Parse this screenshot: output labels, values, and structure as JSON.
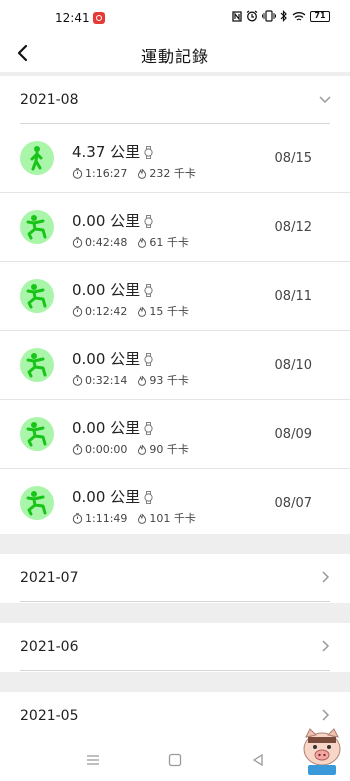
{
  "status": {
    "time": "12:41",
    "battery": "71",
    "left_icons": [
      "notification-icon"
    ],
    "right_icons": [
      "nfc-icon",
      "alarm-icon",
      "vibrate-icon",
      "bluetooth-icon",
      "wifi-icon",
      "battery-icon"
    ]
  },
  "header": {
    "title": "運動記錄"
  },
  "months": [
    {
      "label": "2021-08",
      "expanded": true
    },
    {
      "label": "2021-07",
      "expanded": false
    },
    {
      "label": "2021-06",
      "expanded": false
    },
    {
      "label": "2021-05",
      "expanded": false
    }
  ],
  "records": [
    {
      "distance": "4.37 公里",
      "duration": "1:16:27",
      "calories": "232 千卡",
      "date": "08/15",
      "activity": "walk"
    },
    {
      "distance": "0.00 公里",
      "duration": "0:42:48",
      "calories": "61 千卡",
      "date": "08/12",
      "activity": "workout"
    },
    {
      "distance": "0.00 公里",
      "duration": "0:12:42",
      "calories": "15 千卡",
      "date": "08/11",
      "activity": "workout"
    },
    {
      "distance": "0.00 公里",
      "duration": "0:32:14",
      "calories": "93 千卡",
      "date": "08/10",
      "activity": "workout"
    },
    {
      "distance": "0.00 公里",
      "duration": "0:00:00",
      "calories": "90 千卡",
      "date": "08/09",
      "activity": "workout"
    },
    {
      "distance": "0.00 公里",
      "duration": "1:11:49",
      "calories": "101 千卡",
      "date": "08/07",
      "activity": "workout"
    }
  ],
  "colors": {
    "accent": "#a9f5a9",
    "figure": "#19c419",
    "divider": "#e4e4e4",
    "section_gap": "#eeeeee"
  },
  "navbar": {
    "icons": [
      "menu-icon",
      "home-square-icon",
      "back-triangle-icon"
    ]
  }
}
